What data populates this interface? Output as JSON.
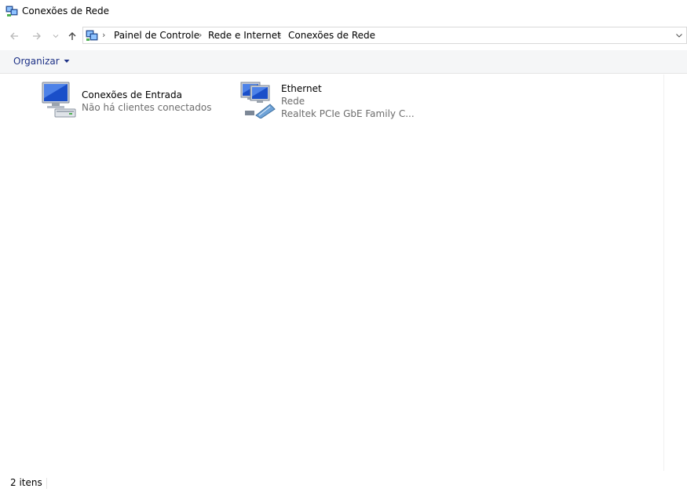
{
  "window": {
    "title": "Conexões de Rede",
    "icon": "network-connections-icon"
  },
  "nav": {
    "back_icon": "arrow-left-icon",
    "forward_icon": "arrow-right-icon",
    "recent_icon": "chevron-down-icon",
    "up_icon": "arrow-up-icon"
  },
  "address": {
    "icon": "control-panel-icon",
    "breadcrumbs": [
      "Painel de Controle",
      "Rede e Internet",
      "Conexões de Rede"
    ],
    "separator": "›"
  },
  "toolbar": {
    "organize_label": "Organizar"
  },
  "items": [
    {
      "name": "Conexões de Entrada",
      "line2": "Não há clientes conectados",
      "line3": "",
      "icon": "incoming-connections-icon"
    },
    {
      "name": "Ethernet",
      "line2": "Rede",
      "line3": "Realtek PCIe GbE Family C...",
      "icon": "ethernet-adapter-icon"
    }
  ],
  "status": {
    "count": "2 itens"
  },
  "colors": {
    "accent": "#1e3287",
    "secondary_text": "#6d6d6d",
    "toolbar_bg": "#f5f6f7"
  }
}
